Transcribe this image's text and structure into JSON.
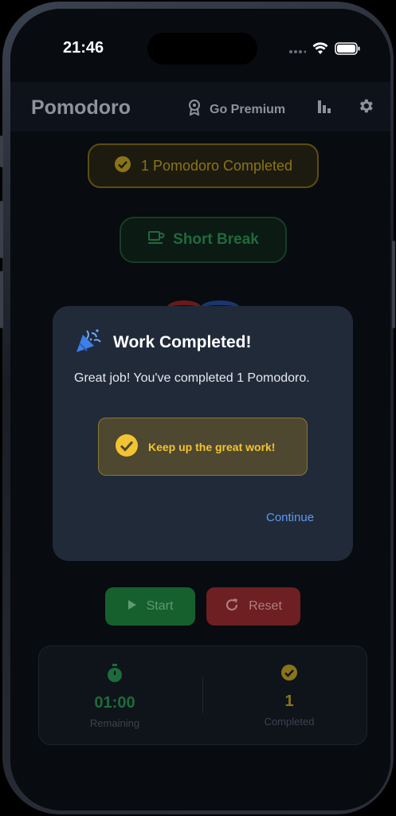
{
  "status_bar": {
    "time": "21:46"
  },
  "app_bar": {
    "title": "Pomodoro",
    "premium_label": "Go Premium"
  },
  "session": {
    "completed_label": "1 Pomodoro Completed",
    "mode_label": "Short Break"
  },
  "controls": {
    "start_label": "Start",
    "reset_label": "Reset"
  },
  "stats": {
    "remaining_value": "01:00",
    "remaining_label": "Remaining",
    "completed_value": "1",
    "completed_label": "Completed"
  },
  "dialog": {
    "title": "Work Completed!",
    "message": "Great job! You've completed 1 Pomodoro.",
    "note": "Keep up the great work!",
    "continue_label": "Continue"
  },
  "colors": {
    "dialog_bg": "#212a39",
    "accent_yellow": "#f2c431",
    "accent_green": "#16602e",
    "accent_red": "#6d1f21",
    "link_blue": "#5c9bf0"
  },
  "icons": [
    "premium-badge-icon",
    "bar-chart-icon",
    "gear-icon",
    "check-circle-icon",
    "coffee-cup-icon",
    "play-icon",
    "refresh-icon",
    "stopwatch-icon",
    "party-popper-icon"
  ]
}
